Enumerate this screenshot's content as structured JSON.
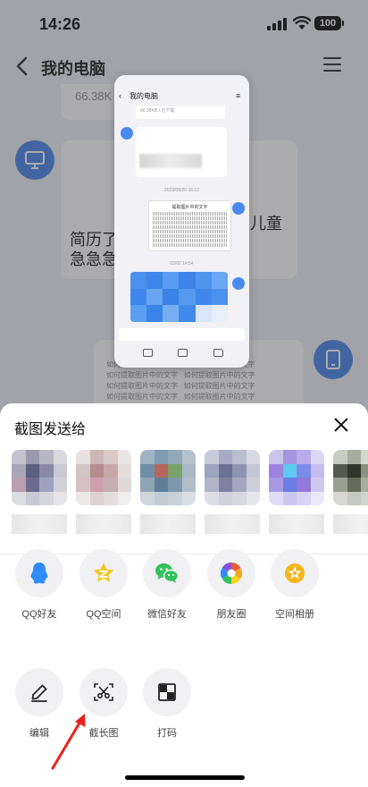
{
  "status_bar": {
    "time": "14:26",
    "battery": "100"
  },
  "nav": {
    "title": "我的电脑"
  },
  "chat": {
    "file_size": "66.38K",
    "message_text": "简历了\n急急急",
    "message_text_right": "儿童",
    "repeated_caption": "如何提取图片中的文字"
  },
  "preview": {
    "title": "我的电脑",
    "file_meta": "66.38KB / 已下载",
    "time1": "2023/09/20 16:12",
    "time2": "02/02 14:54",
    "doc_heading": "提取图片中的文字"
  },
  "sheet": {
    "title": "截图发送给",
    "share_targets": [
      {
        "label": "QQ好友",
        "icon": "qq-penguin-icon",
        "color": "#2f8bf7"
      },
      {
        "label": "QQ空间",
        "icon": "qzone-star-icon",
        "color": "#f5c41c"
      },
      {
        "label": "微信好友",
        "icon": "wechat-icon",
        "color": "#33c25b"
      },
      {
        "label": "朋友圈",
        "icon": "moments-aperture-icon",
        "color": "#e55c3b"
      },
      {
        "label": "空间相册",
        "icon": "album-flower-icon",
        "color": "#f5b51c"
      }
    ],
    "actions": [
      {
        "label": "编辑",
        "icon": "pencil-icon"
      },
      {
        "label": "截长图",
        "icon": "scissors-icon"
      },
      {
        "label": "打码",
        "icon": "mosaic-icon"
      }
    ]
  },
  "colors": {
    "accent_blue": "#3f7ee6",
    "annotation_arrow": "#e8231d"
  }
}
